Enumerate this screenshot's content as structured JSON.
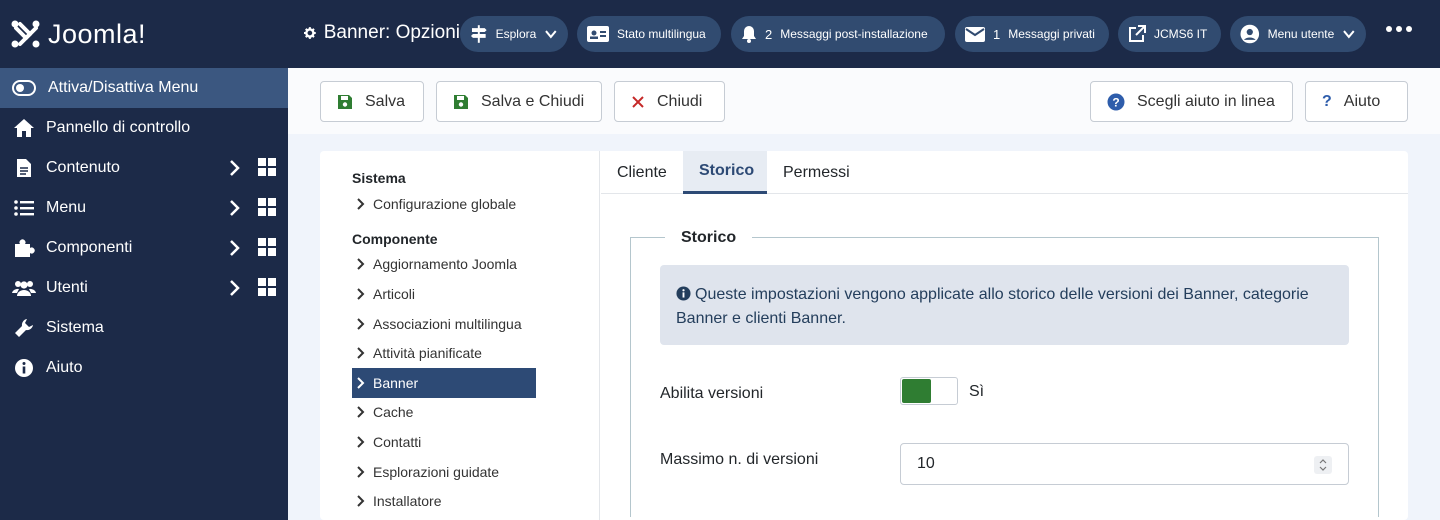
{
  "sidebar": {
    "logo_text": "Joomla!",
    "toggle_label": "Attiva/Disattiva Menu",
    "items": [
      {
        "label": "Pannello di controllo",
        "icon": "home-icon"
      },
      {
        "label": "Contenuto",
        "icon": "file-icon"
      },
      {
        "label": "Menu",
        "icon": "list-icon"
      },
      {
        "label": "Componenti",
        "icon": "puzzle-icon"
      },
      {
        "label": "Utenti",
        "icon": "users-icon"
      },
      {
        "label": "Sistema",
        "icon": "wrench-icon"
      },
      {
        "label": "Aiuto",
        "icon": "info-icon"
      }
    ]
  },
  "header": {
    "title": "Banner: Opzioni",
    "buttons": {
      "esplora": "Esplora",
      "multilingua": "Stato multilingua",
      "post_install_count": "2",
      "post_install": "Messaggi post-installazione",
      "private_count": "1",
      "private": "Messaggi privati",
      "site": "JCMS6 IT",
      "user_menu": "Menu utente"
    }
  },
  "toolbar": {
    "save": "Salva",
    "save_close": "Salva e Chiudi",
    "close": "Chiudi",
    "online_help": "Scegli aiuto in linea",
    "help": "Aiuto"
  },
  "leftnav": {
    "system_heading": "Sistema",
    "system_items": [
      "Configurazione globale"
    ],
    "component_heading": "Componente",
    "component_items": [
      "Aggiornamento Joomla",
      "Articoli",
      "Associazioni multilingua",
      "Attività pianificate",
      "Banner",
      "Cache",
      "Contatti",
      "Esplorazioni guidate",
      "Installatore"
    ],
    "active_item": "Banner"
  },
  "tabs": [
    "Cliente",
    "Storico",
    "Permessi"
  ],
  "active_tab": "Storico",
  "history": {
    "legend": "Storico",
    "alert": "Queste impostazioni vengono applicate allo storico delle versioni dei Banner, categorie Banner e clienti Banner.",
    "enable_label": "Abilita versioni",
    "enable_value": "Sì",
    "enable_on": true,
    "max_label": "Massimo n. di versioni",
    "max_value": "10"
  },
  "colors": {
    "sidebar_bg": "#1c2a48",
    "sidebar_active": "#3b5780",
    "accent": "#2d4a75",
    "switch_on": "#2f7d32",
    "close_red": "#c52827"
  }
}
